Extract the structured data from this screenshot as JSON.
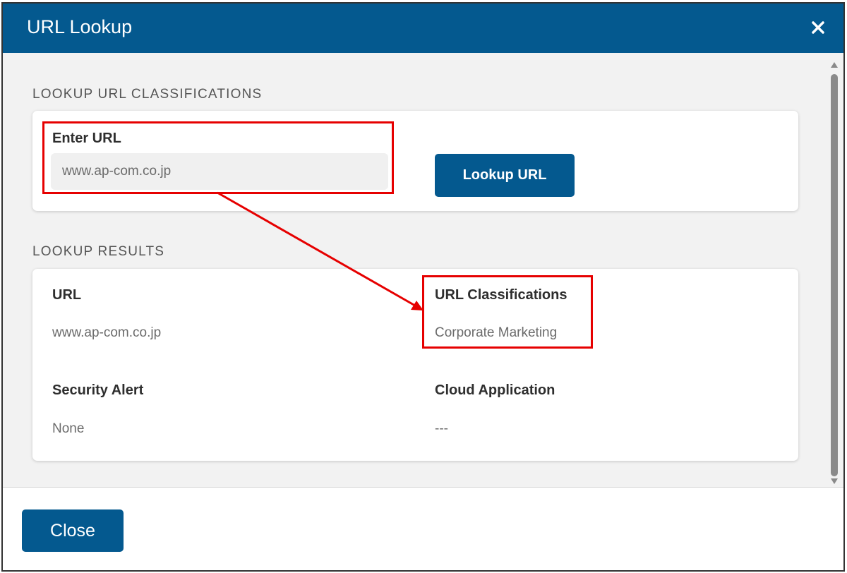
{
  "dialog": {
    "title": "URL Lookup",
    "close_icon": "close-x-icon"
  },
  "lookup": {
    "section_label": "LOOKUP URL CLASSIFICATIONS",
    "enter_url_label": "Enter URL",
    "url_value": "www.ap-com.co.jp",
    "button_label": "Lookup URL"
  },
  "results": {
    "section_label": "LOOKUP RESULTS",
    "url_label": "URL",
    "url_value": "www.ap-com.co.jp",
    "classifications_label": "URL Classifications",
    "classifications_value": "Corporate Marketing",
    "security_label": "Security Alert",
    "security_value": "None",
    "cloud_label": "Cloud Application",
    "cloud_value": "---"
  },
  "footer": {
    "close_label": "Close"
  },
  "colors": {
    "brand": "#04598f",
    "annotation": "#e60000"
  }
}
